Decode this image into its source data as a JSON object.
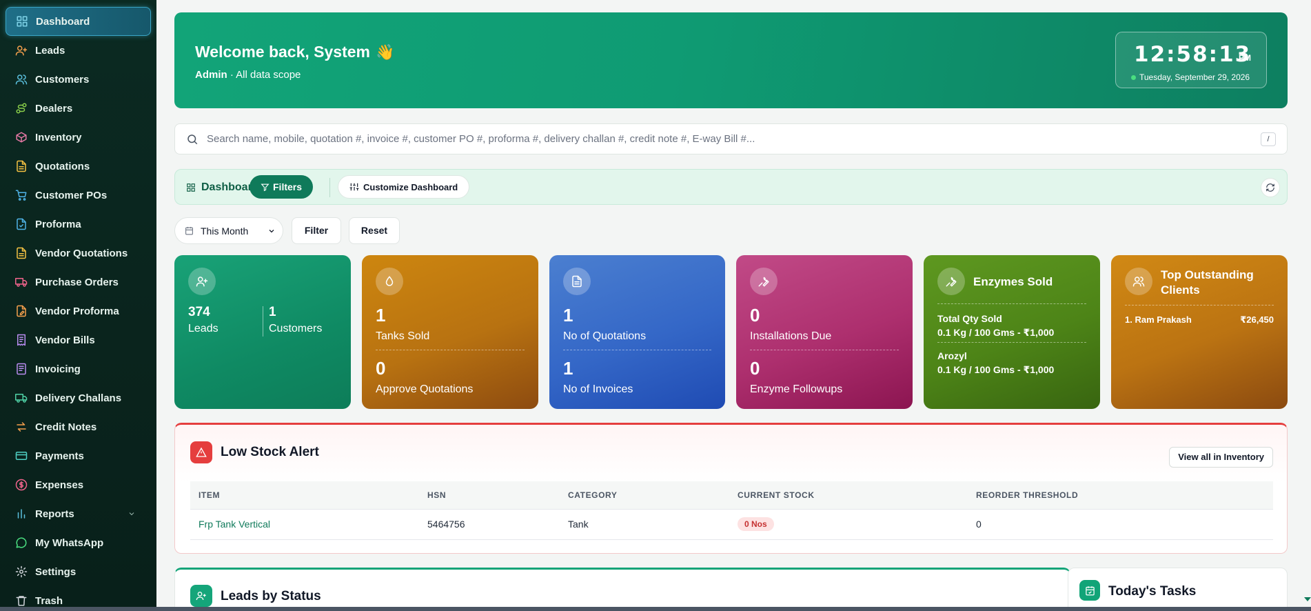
{
  "sidebar": {
    "items": [
      {
        "label": "Dashboard",
        "icon": "grid-icon",
        "color": "#7fd3e8"
      },
      {
        "label": "Leads",
        "icon": "user-plus-icon",
        "color": "#f6a04d"
      },
      {
        "label": "Customers",
        "icon": "users-icon",
        "color": "#5bc0de"
      },
      {
        "label": "Dealers",
        "icon": "route-icon",
        "color": "#8bd04a"
      },
      {
        "label": "Inventory",
        "icon": "box-icon",
        "color": "#e879a6"
      },
      {
        "label": "Quotations",
        "icon": "file-text-icon",
        "color": "#f5c242"
      },
      {
        "label": "Customer POs",
        "icon": "cart-icon",
        "color": "#4fb3e8"
      },
      {
        "label": "Proforma",
        "icon": "file-check-icon",
        "color": "#4fb3e8"
      },
      {
        "label": "Vendor Quotations",
        "icon": "file-text-icon",
        "color": "#f5c242"
      },
      {
        "label": "Purchase Orders",
        "icon": "truck-icon",
        "color": "#f0648c"
      },
      {
        "label": "Vendor Proforma",
        "icon": "file-edit-icon",
        "color": "#f6a04d"
      },
      {
        "label": "Vendor Bills",
        "icon": "receipt-icon",
        "color": "#b98cf0"
      },
      {
        "label": "Invoicing",
        "icon": "file-lines-icon",
        "color": "#b98cf0"
      },
      {
        "label": "Delivery Challans",
        "icon": "truck-icon",
        "color": "#4fd1a5"
      },
      {
        "label": "Credit Notes",
        "icon": "arrows-swap-icon",
        "color": "#f6a04d"
      },
      {
        "label": "Payments",
        "icon": "credit-card-icon",
        "color": "#4fd1c5"
      },
      {
        "label": "Expenses",
        "icon": "dollar-circle-icon",
        "color": "#f0648c"
      },
      {
        "label": "Reports",
        "icon": "bar-chart-icon",
        "color": "#5bc0de"
      },
      {
        "label": "My WhatsApp",
        "icon": "message-circle-icon",
        "color": "#4ade80"
      },
      {
        "label": "Settings",
        "icon": "gear-icon",
        "color": "#d1d5db"
      },
      {
        "label": "Trash",
        "icon": "trash-icon",
        "color": "#d1d5db"
      }
    ]
  },
  "hero": {
    "title": "Welcome back, System",
    "wave": "👋",
    "role": "Admin",
    "scope": " · All data scope",
    "time": "12:58:13",
    "ampm": "PM",
    "date": "Tuesday, September 29, 2026"
  },
  "search": {
    "placeholder": "Search name, mobile, quotation #, invoice #, customer PO #, proforma #, delivery challan #, credit note #, E-way Bill #...",
    "shortcut": "/"
  },
  "toolbar": {
    "dashboard_label": "Dashboard",
    "filters_label": "Filters",
    "customize_label": "Customize Dashboard"
  },
  "filters": {
    "period": "This Month",
    "filter_label": "Filter",
    "reset_label": "Reset"
  },
  "cards": {
    "leads": {
      "leads_value": "374",
      "leads_label": "Leads",
      "customers_value": "1",
      "customers_label": "Customers"
    },
    "tanks": {
      "v1": "1",
      "l1": "Tanks Sold",
      "v2": "0",
      "l2": "Approve Quotations"
    },
    "quotes": {
      "v1": "1",
      "l1": "No of Quotations",
      "v2": "1",
      "l2": "No of Invoices"
    },
    "installs": {
      "v1": "0",
      "l1": "Installations Due",
      "v2": "0",
      "l2": "Enzyme Followups"
    },
    "enzymes": {
      "title": "Enzymes Sold",
      "r1_label": "Total Qty Sold",
      "r1_value": "0.1 Kg / 100 Gms - ₹1,000",
      "r2_label": "Arozyl",
      "r2_value": "0.1 Kg / 100 Gms - ₹1,000"
    },
    "outstanding": {
      "title_line1": "Top Outstanding",
      "title_line2": "Clients",
      "client": "1. Ram Prakash",
      "amount": "₹26,450"
    }
  },
  "low_stock": {
    "title": "Low Stock Alert",
    "view_all": "View all in Inventory",
    "columns": [
      "ITEM",
      "HSN",
      "CATEGORY",
      "CURRENT STOCK",
      "REORDER THRESHOLD"
    ],
    "rows": [
      {
        "item": "Frp Tank Vertical",
        "hsn": "5464756",
        "category": "Tank",
        "stock": "0 Nos",
        "threshold": "0"
      }
    ]
  },
  "panels": {
    "leads_status": "Leads by Status",
    "tasks": "Today's Tasks"
  }
}
